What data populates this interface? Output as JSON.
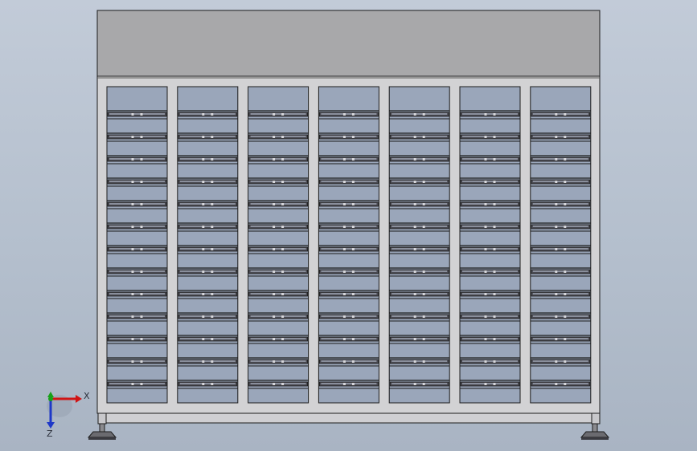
{
  "app": {
    "view": "front"
  },
  "model": {
    "name": "drawer cabinet",
    "columns": 7,
    "drawers_per_column": 13
  },
  "triad": {
    "x_label": "X",
    "z_label": "Z"
  },
  "colors": {
    "background_top": "#c2cbd8",
    "background_bottom": "#a9b4c3",
    "frame": "#d2d2d4",
    "header_panel": "#a8a8aa",
    "drawer_front": "#9aa6ba",
    "handle_dark": "#4a4a52",
    "outline": "#1c1c1c",
    "x_axis": "#d11414",
    "y_axis": "#18a018",
    "z_axis": "#1e38c8"
  }
}
